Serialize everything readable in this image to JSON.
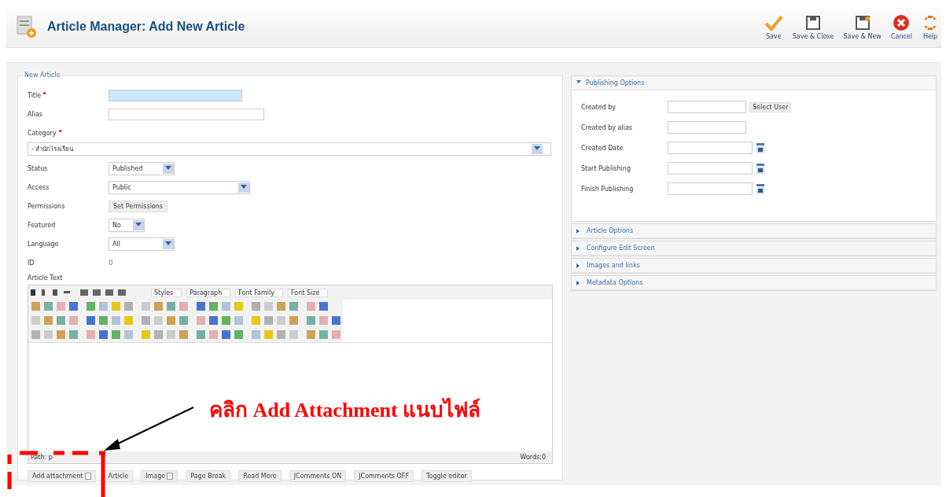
{
  "header": {
    "title": "Article Manager: Add New Article",
    "toolbar": [
      {
        "label": "Save",
        "kind": "save"
      },
      {
        "label": "Save & Close",
        "kind": "save-close"
      },
      {
        "label": "Save & New",
        "kind": "save-new"
      },
      {
        "label": "Cancel",
        "kind": "cancel"
      },
      {
        "label": "Help",
        "kind": "help"
      }
    ]
  },
  "form": {
    "legend": "New Article",
    "fields": [
      {
        "label": "Title",
        "required": true,
        "kind": "input",
        "focused": true
      },
      {
        "label": "Alias",
        "required": false,
        "kind": "input",
        "focused": false
      },
      {
        "label": "Category",
        "required": true,
        "kind": "wide-select",
        "value": "- สำนักโรงเรียน"
      },
      {
        "label": "Status",
        "required": false,
        "kind": "select",
        "value": "Published"
      },
      {
        "label": "Access",
        "required": false,
        "kind": "select",
        "value": "Public"
      },
      {
        "label": "Permissions",
        "required": false,
        "kind": "button",
        "value": "Set Permissions"
      },
      {
        "label": "Featured",
        "required": false,
        "kind": "select",
        "value": "No"
      },
      {
        "label": "Language",
        "required": false,
        "kind": "select",
        "value": "All"
      },
      {
        "label": "ID",
        "required": false,
        "kind": "text",
        "value": "0"
      }
    ]
  },
  "editor": {
    "label": "Article Text",
    "dropdowns": [
      "Styles",
      "Paragraph",
      "Font Family",
      "Font Size"
    ],
    "path": "Path: p",
    "words": "Words:0"
  },
  "buttons": [
    "Add attachment",
    "Article",
    "Image",
    "Page Break",
    "Read More",
    "JComments ON",
    "JComments OFF",
    "Toggle editor"
  ],
  "panels": [
    {
      "title": "Publishing Options",
      "expanded": true
    },
    {
      "title": "Article Options",
      "expanded": false
    },
    {
      "title": "Configure Edit Screen",
      "expanded": false
    },
    {
      "title": "Images and links",
      "expanded": false
    },
    {
      "title": "Metadata Options",
      "expanded": false
    }
  ],
  "publishing": {
    "fields": [
      {
        "label": "Created by",
        "kind": "user",
        "button": "Select User"
      },
      {
        "label": "Created by alias",
        "kind": "input"
      },
      {
        "label": "Created Date",
        "kind": "date"
      },
      {
        "label": "Start Publishing",
        "kind": "date"
      },
      {
        "label": "Finish Publishing",
        "kind": "date"
      }
    ]
  },
  "annotation": {
    "text": "คลิก Add Attachment แนบไฟล์"
  }
}
